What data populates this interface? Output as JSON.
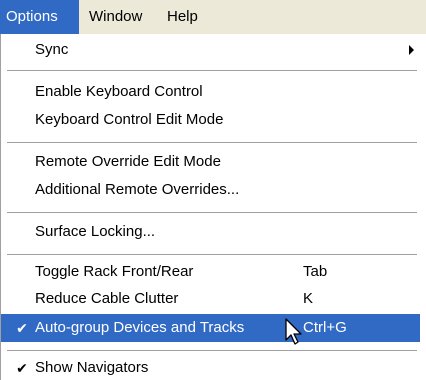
{
  "menubar": {
    "items": [
      {
        "label": "Options",
        "active": true
      },
      {
        "label": "Window",
        "active": false
      },
      {
        "label": "Help",
        "active": false
      }
    ]
  },
  "menu": {
    "sync": {
      "label": "Sync",
      "has_submenu": true
    },
    "enable_keyboard_control": {
      "label": "Enable Keyboard Control"
    },
    "keyboard_control_edit_mode": {
      "label": "Keyboard Control Edit Mode"
    },
    "remote_override_edit_mode": {
      "label": "Remote Override Edit Mode"
    },
    "additional_remote_overrides": {
      "label": "Additional Remote Overrides..."
    },
    "surface_locking": {
      "label": "Surface Locking..."
    },
    "toggle_rack": {
      "label": "Toggle Rack Front/Rear",
      "shortcut": "Tab"
    },
    "reduce_cable_clutter": {
      "label": "Reduce Cable Clutter",
      "shortcut": "K"
    },
    "auto_group": {
      "label": "Auto-group Devices and Tracks",
      "shortcut": "Ctrl+G",
      "checked": true,
      "highlighted": true
    },
    "show_navigators": {
      "label": "Show Navigators",
      "checked": true
    }
  },
  "colors": {
    "highlight": "#316ac5",
    "menubar_bg": "#ece9d8"
  },
  "icons": {
    "check": "checkmark-icon",
    "submenu": "chevron-right-icon",
    "cursor": "mouse-pointer-icon"
  }
}
